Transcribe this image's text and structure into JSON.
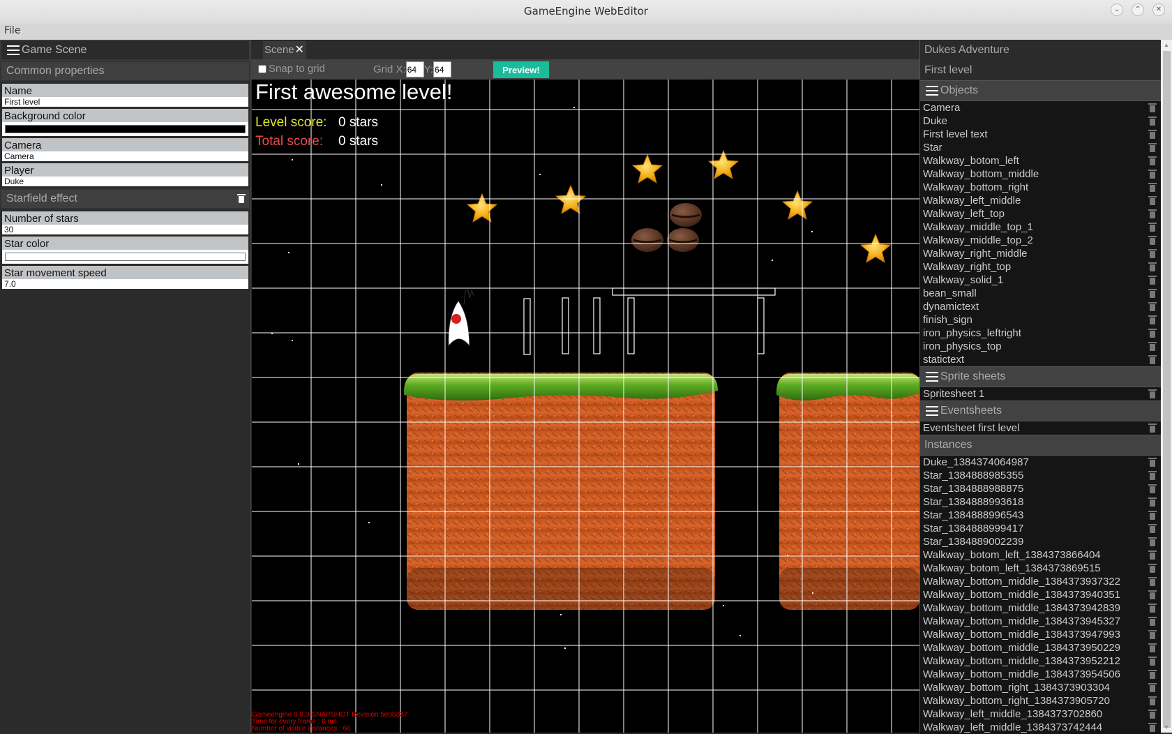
{
  "window": {
    "title": "GameEngine WebEditor",
    "buttons": [
      "minimize",
      "maximize",
      "close"
    ]
  },
  "menu": {
    "file": "File"
  },
  "left": {
    "panel_title": "Game Scene",
    "common_section": "Common properties",
    "props": [
      {
        "label": "Name",
        "value": "First level"
      },
      {
        "label": "Background color",
        "color": "#000000"
      },
      {
        "label": "Camera",
        "value": "Camera"
      },
      {
        "label": "Player",
        "value": "Duke"
      }
    ],
    "starfield_section": "Starfield effect",
    "starfield_props": [
      {
        "label": "Number of stars",
        "value": "30"
      },
      {
        "label": "Star color",
        "color": "#ffffff"
      },
      {
        "label": "Star movement speed",
        "value": "7.0"
      }
    ]
  },
  "center": {
    "tab_label": "Scene",
    "tab_close": "✕",
    "snap_label": "Snap to grid",
    "snap_checked": false,
    "grid_x_label": "Grid X:",
    "grid_x": "64",
    "grid_y_label": "Y:",
    "grid_y": "64",
    "preview_label": "Preview!",
    "scene": {
      "title": "First awesome level!",
      "level_score_label": "Level score:",
      "level_score_value": "0 stars",
      "total_score_label": "Total score:",
      "total_score_value": "0 stars",
      "level_score_color": "#e5e533",
      "total_score_color": "#e74c4c",
      "debug_lines": [
        "Gameengine 0.0.0-SNAPSHOT Revision 5e0b337",
        "Time for every frame : 0 ms",
        "Number of visible instances : 66"
      ]
    }
  },
  "right": {
    "project_title": "Dukes Adventure",
    "level_title": "First level",
    "objects_title": "Objects",
    "objects": [
      "Camera",
      "Duke",
      "First level text",
      "Star",
      "Walkway_botom_left",
      "Walkway_bottom_middle",
      "Walkway_bottom_right",
      "Walkway_left_middle",
      "Walkway_left_top",
      "Walkway_middle_top_1",
      "Walkway_middle_top_2",
      "Walkway_right_middle",
      "Walkway_right_top",
      "Walkway_solid_1",
      "bean_small",
      "dynamictext",
      "finish_sign",
      "iron_physics_leftright",
      "iron_physics_top",
      "statictext"
    ],
    "sprites_title": "Sprite sheets",
    "sprites": [
      "Spritesheet 1"
    ],
    "events_title": "Eventsheets",
    "events": [
      "Eventsheet first level"
    ],
    "instances_title": "Instances",
    "instances": [
      "Duke_1384374064987",
      "Star_1384888985355",
      "Star_1384888988875",
      "Star_1384888993618",
      "Star_1384888996543",
      "Star_1384888999417",
      "Star_1384889002239",
      "Walkway_botom_left_1384373866404",
      "Walkway_botom_left_1384373869515",
      "Walkway_bottom_middle_1384373937322",
      "Walkway_bottom_middle_1384373940351",
      "Walkway_bottom_middle_1384373942839",
      "Walkway_bottom_middle_1384373945327",
      "Walkway_bottom_middle_1384373947993",
      "Walkway_bottom_middle_1384373950229",
      "Walkway_bottom_middle_1384373952212",
      "Walkway_bottom_middle_1384373954506",
      "Walkway_bottom_right_1384373903304",
      "Walkway_bottom_right_1384373905720",
      "Walkway_left_middle_1384373702860",
      "Walkway_left_middle_1384373742444"
    ]
  },
  "colors": {
    "accent": "#1abc9c",
    "panel": "#2b2b2b",
    "list_bg": "#151515"
  }
}
